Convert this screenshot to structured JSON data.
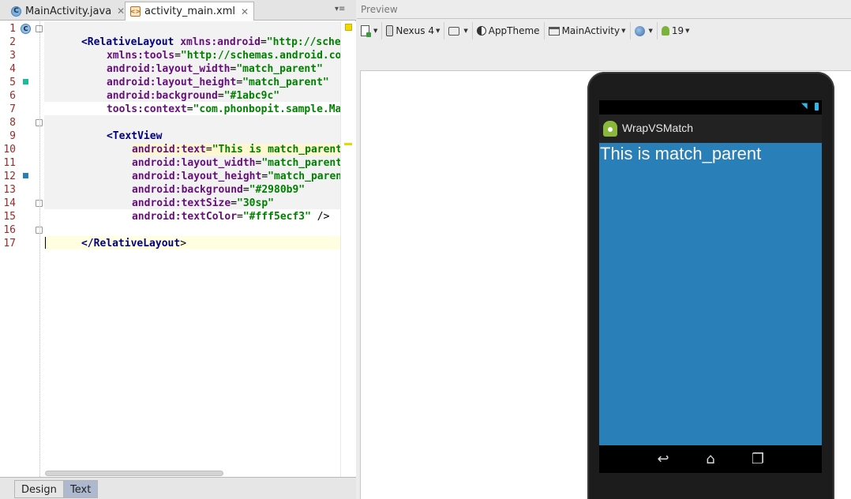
{
  "editor": {
    "tabs": [
      {
        "label": "MainActivity.java",
        "icon": "java-class-icon",
        "letter": "C"
      },
      {
        "label": "activity_main.xml",
        "icon": "xml-file-icon",
        "letter": "<>"
      }
    ],
    "gutter_class_letter": "C",
    "line_numbers": [
      "1",
      "2",
      "3",
      "4",
      "5",
      "6",
      "7",
      "8",
      "9",
      "10",
      "11",
      "12",
      "13",
      "14",
      "15",
      "16",
      "17"
    ],
    "colors": {
      "line5_marker": "#1abc9c",
      "line12_marker": "#2980b9"
    },
    "code": {
      "l1": {
        "tag": "<RelativeLayout",
        "attr": " xmlns:android",
        "eq": "=",
        "val": "\"http://schemas.a"
      },
      "l2": {
        "attr": "xmlns:tools",
        "eq": "=",
        "val": "\"http://schemas.android.com/too"
      },
      "l3": {
        "attr": "android:layout_width",
        "eq": "=",
        "val": "\"match_parent\""
      },
      "l4": {
        "attr": "android:layout_height",
        "eq": "=",
        "val": "\"match_parent\""
      },
      "l5": {
        "attr": "android:background",
        "eq": "=",
        "val": "\"#1abc9c\""
      },
      "l6": {
        "attr": "tools:context",
        "eq": "=",
        "val": "\"com.phonbopit.sample.MainAct"
      },
      "l8": {
        "tag": "<TextView"
      },
      "l9": {
        "attr": "android:text",
        "eq": "=",
        "val": "\"This is match_parent\""
      },
      "l10": {
        "attr": "android:layout_width",
        "eq": "=",
        "val": "\"match_parent\""
      },
      "l11": {
        "attr": "android:layout_height",
        "eq": "=",
        "val": "\"match_parent\""
      },
      "l12": {
        "attr": "android:background",
        "eq": "=",
        "val": "\"#2980b9\""
      },
      "l13": {
        "attr": "android:textSize",
        "eq": "=",
        "val": "\"30sp\""
      },
      "l14": {
        "attr": "android:textColor",
        "eq": "=",
        "val": "\"#fff5ecf3\"",
        "end": " />"
      },
      "l16": {
        "tag": "</RelativeLayout",
        "close": ">"
      }
    },
    "bottom_tabs": {
      "design": "Design",
      "text": "Text"
    }
  },
  "preview": {
    "header": "Preview",
    "toolbar": {
      "device": "Nexus 4",
      "theme": "AppTheme",
      "activity": "MainActivity",
      "api": "19"
    },
    "device_screen": {
      "app_title": "WrapVSMatch",
      "text": "This is match_parent",
      "colors": {
        "content_bg": "#2980b9",
        "text": "#fff5ec",
        "status_icons": "#33b5e5"
      }
    }
  }
}
